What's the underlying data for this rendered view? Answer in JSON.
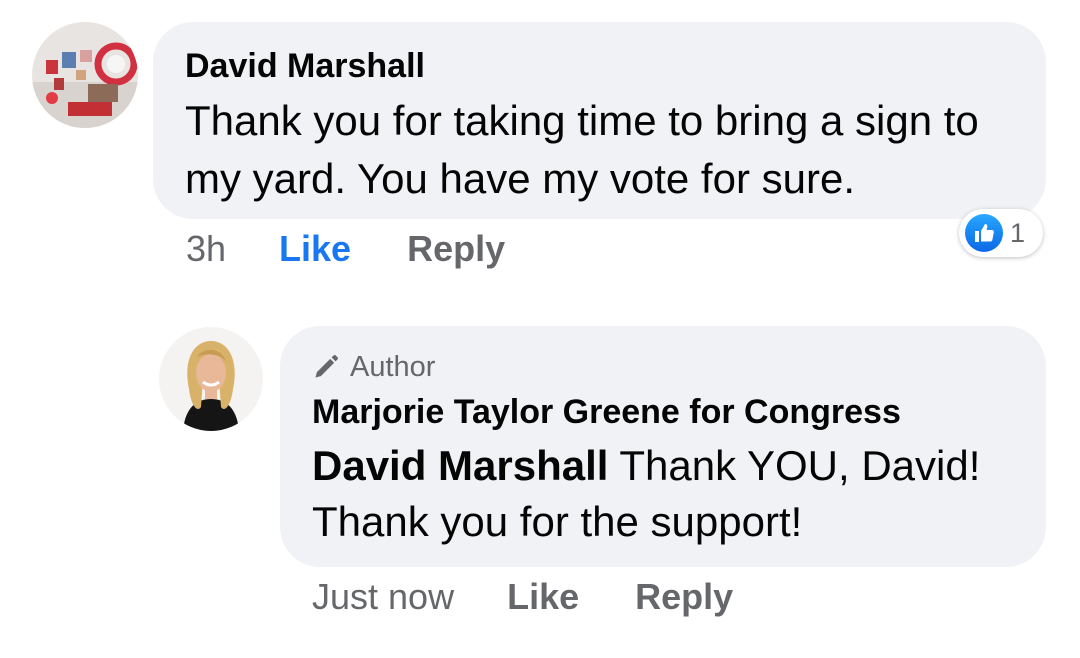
{
  "comment": {
    "author": "David Marshall",
    "text": "Thank you for taking time to bring a sign to my yard. You have my vote for sure.",
    "timestamp": "3h",
    "like_label": "Like",
    "reply_label": "Reply",
    "reaction_count": "1",
    "reaction_icon": "thumbs-up-icon",
    "like_color": "#1877f2"
  },
  "reply": {
    "badge": "Author",
    "badge_icon": "pencil-icon",
    "author": "Marjorie Taylor Greene for Congress",
    "mention": "David Marshall",
    "text_line1": " Thank YOU, David!",
    "text_line2": "Thank you for the support!",
    "timestamp": "Just now",
    "like_label": "Like",
    "reply_label": "Reply"
  },
  "colors": {
    "bubble": "#f0f2f5",
    "secondary_text": "#65676b",
    "primary_text": "#050505"
  }
}
